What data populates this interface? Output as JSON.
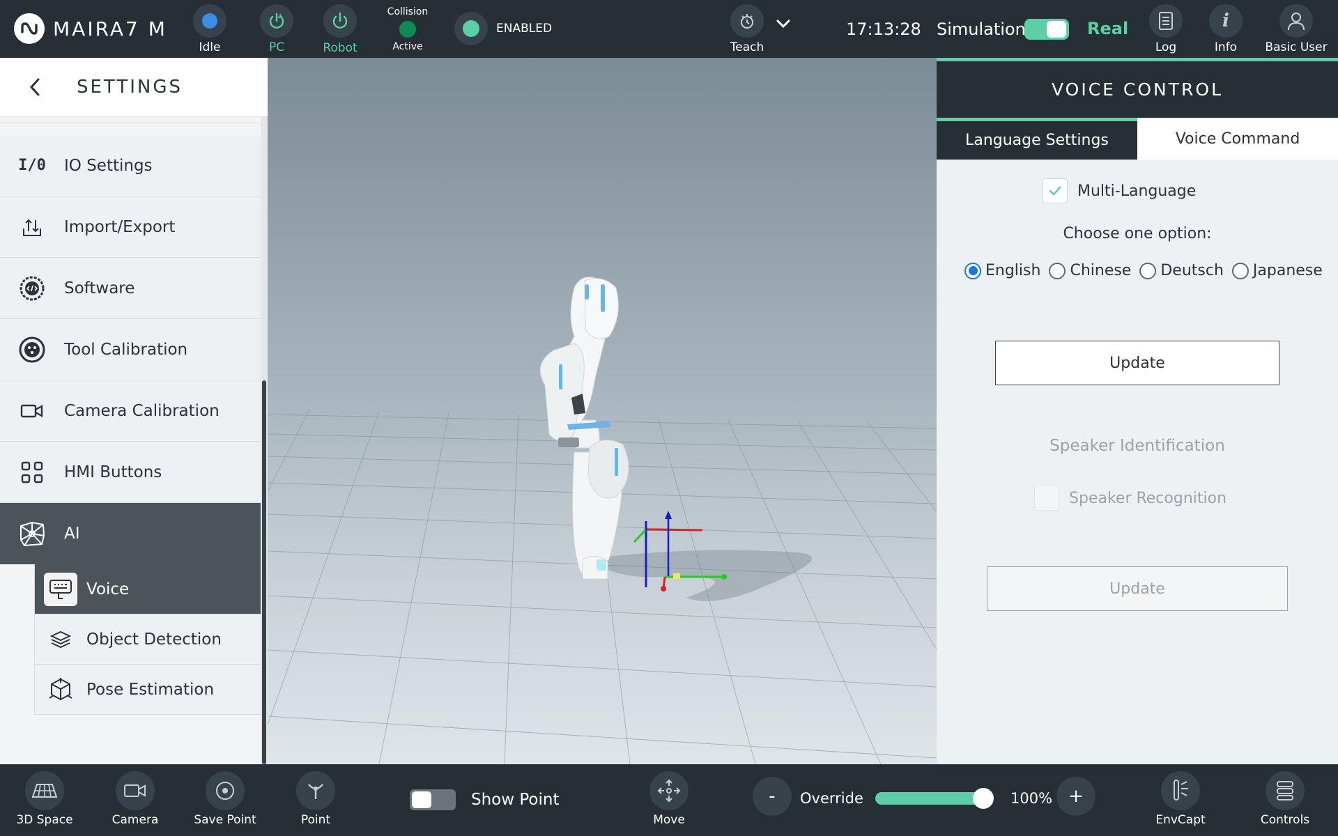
{
  "topbar": {
    "brand": "MAIRA7 M",
    "idle_label": "Idle",
    "pc_label": "PC",
    "robot_label": "Robot",
    "collision_title": "Collision",
    "collision_status": "Active",
    "enabled_label": "ENABLED",
    "teach_label": "Teach",
    "time": "17:13:28",
    "simulation_label": "Simulation",
    "real_label": "Real",
    "log_label": "Log",
    "info_label": "Info",
    "user_label": "Basic User"
  },
  "sidebar": {
    "title": "SETTINGS",
    "items": [
      {
        "label": "IO Settings",
        "icon": "io-icon"
      },
      {
        "label": "Import/Export",
        "icon": "import-export-icon"
      },
      {
        "label": "Software",
        "icon": "software-icon"
      },
      {
        "label": "Tool Calibration",
        "icon": "tool-calibration-icon"
      },
      {
        "label": "Camera Calibration",
        "icon": "camera-icon"
      },
      {
        "label": "HMI Buttons",
        "icon": "grid-icon"
      },
      {
        "label": "AI",
        "icon": "ai-icon"
      }
    ],
    "sub_items": [
      {
        "label": "Voice",
        "icon": "voice-icon"
      },
      {
        "label": "Object Detection",
        "icon": "layers-icon"
      },
      {
        "label": "Pose Estimation",
        "icon": "pose-icon"
      }
    ]
  },
  "panel": {
    "title": "VOICE CONTROL",
    "tabs": [
      "Language Settings",
      "Voice Command"
    ],
    "multi_language_label": "Multi-Language",
    "choose_label": "Choose one option:",
    "languages": [
      "English",
      "Chinese",
      "Deutsch",
      "Japanese"
    ],
    "selected_language": "English",
    "update_label": "Update",
    "speaker_title": "Speaker Identification",
    "speaker_recognition_label": "Speaker Recognition",
    "update2_label": "Update"
  },
  "bottombar": {
    "space_label": "3D Space",
    "camera_label": "Camera",
    "save_point_label": "Save Point",
    "point_label": "Point",
    "show_point_label": "Show Point",
    "move_label": "Move",
    "override_label": "Override",
    "override_value": "100%",
    "minus_label": "-",
    "plus_label": "+",
    "envcapt_label": "EnvCapt",
    "controls_label": "Controls"
  },
  "colors": {
    "accent": "#5ccfa6",
    "bar_bg": "#262f35",
    "radio_blue": "#1a73e8"
  }
}
